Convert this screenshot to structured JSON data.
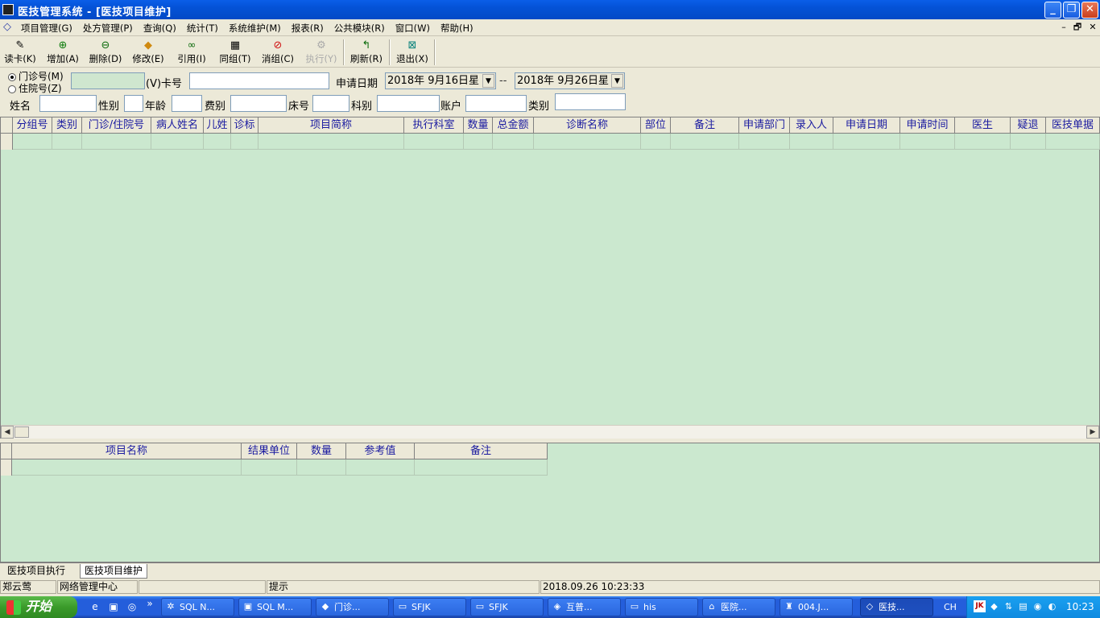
{
  "window": {
    "title": "医技管理系统 - [医技项目维护]",
    "controls": {
      "minimize": "_",
      "restore": "❐",
      "close": "✕"
    }
  },
  "menu": {
    "items": [
      "项目管理(G)",
      "处方管理(P)",
      "查询(Q)",
      "统计(T)",
      "系统维护(M)",
      "报表(R)",
      "公共模块(R)",
      "窗口(W)",
      "帮助(H)"
    ],
    "mdi_controls": {
      "minimize": "–",
      "restore": "🗗",
      "close": "✕"
    }
  },
  "toolbar": {
    "buttons": [
      {
        "label": "读卡(K)",
        "icon": "card-reader-icon",
        "enabled": true
      },
      {
        "label": "增加(A)",
        "icon": "add-icon",
        "enabled": true
      },
      {
        "label": "删除(D)",
        "icon": "delete-icon",
        "enabled": true
      },
      {
        "label": "修改(E)",
        "icon": "edit-icon",
        "enabled": true
      },
      {
        "label": "引用(I)",
        "icon": "binoculars-icon",
        "enabled": true
      },
      {
        "label": "同组(T)",
        "icon": "group-icon",
        "enabled": true
      },
      {
        "label": "消组(C)",
        "icon": "ungroup-icon",
        "enabled": true
      },
      {
        "label": "执行(Y)",
        "icon": "execute-icon",
        "enabled": false
      },
      {
        "label": "刷新(R)",
        "icon": "refresh-icon",
        "enabled": true
      },
      {
        "label": "退出(X)",
        "icon": "exit-icon",
        "enabled": true
      }
    ]
  },
  "query": {
    "radio_outpatient": "门诊号(M)",
    "radio_inpatient": "住院号(Z)",
    "selected": "outpatient",
    "card_label": "(V)卡号",
    "apply_date_label": "申请日期",
    "date_from": "2018年 9月16日星",
    "date_sep": "--",
    "date_to": "2018年 9月26日星",
    "name_label": "姓名",
    "gender_label": "性别",
    "age_label": "年龄",
    "fee_label": "费别",
    "bed_label": "床号",
    "dept_label": "科别",
    "account_label": "账户",
    "category_label": "类别"
  },
  "main_grid": {
    "columns": [
      "分组号",
      "类别",
      "门诊/住院号",
      "病人姓名",
      "儿姓",
      "诊标",
      "项目简称",
      "执行科室",
      "数量",
      "总金额",
      "诊断名称",
      "部位",
      "备注",
      "申请部门",
      "录入人",
      "申请日期",
      "申请时间",
      "医生",
      "疑退",
      "医技单据"
    ]
  },
  "detail_grid": {
    "columns": [
      "项目名称",
      "结果单位",
      "数量",
      "参考值",
      "备注"
    ]
  },
  "tabs": [
    "医技项目执行",
    "医技项目维护"
  ],
  "active_tab": "医技项目维护",
  "status": {
    "user": "郑云莺",
    "center": "网络管理中心",
    "hint_label": "提示",
    "datetime": "2018.09.26 10:23:33"
  },
  "taskbar": {
    "start": "开始",
    "tasks": [
      "SQL N...",
      "SQL M...",
      "门诊...",
      "SFJK",
      "SFJK",
      "互普...",
      "his",
      "医院...",
      "004.J...",
      "医技..."
    ],
    "lang": "CH",
    "clock": "10:23"
  },
  "colors": {
    "grid_bg": "#cbe8cf",
    "header_text": "#1a1aa0",
    "titlebar": "#0452d6"
  }
}
